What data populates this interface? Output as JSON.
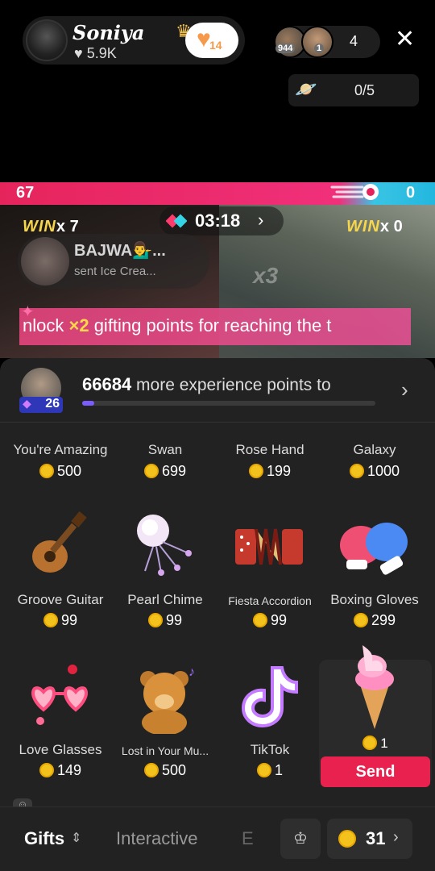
{
  "host": {
    "name": "Soniya",
    "crown_icon": "crown-icon",
    "likes": "5.9K",
    "follow_count": "14"
  },
  "viewers": {
    "badge1": "944",
    "badge2": "1",
    "count": "4"
  },
  "treasure": {
    "value": "0/5"
  },
  "battle": {
    "score_left": "67",
    "score_right": "0",
    "left_ratio": 0.78,
    "win_word": "WIN",
    "win_left": "x 7",
    "win_right": "x 0",
    "timer": "03:18",
    "x3": "x3"
  },
  "gift_notice": {
    "name": "BAJWA💁‍♂️...",
    "sub": "sent Ice Crea..."
  },
  "banner": {
    "pre": "nlock ",
    "highlight": "×2",
    "post": " gifting points for reaching the t"
  },
  "xp": {
    "level": "26",
    "points": "66684",
    "text": " more experience points to",
    "progress": 0.04
  },
  "gifts": [
    {
      "name": "You're Amazing",
      "price": "500"
    },
    {
      "name": "Swan",
      "price": "699"
    },
    {
      "name": "Rose Hand",
      "price": "199"
    },
    {
      "name": "Galaxy",
      "price": "1000"
    },
    {
      "name": "Groove Guitar",
      "price": "99"
    },
    {
      "name": "Pearl Chime",
      "price": "99"
    },
    {
      "name": "Fiesta Accordion",
      "price": "99"
    },
    {
      "name": "Boxing Gloves",
      "price": "299"
    },
    {
      "name": "Love Glasses",
      "price": "149"
    },
    {
      "name": "Lost in Your Mu...",
      "price": "500"
    },
    {
      "name": "TikTok",
      "price": "1"
    }
  ],
  "selected": {
    "price": "1",
    "send_label": "Send"
  },
  "bottom": {
    "tab_gifts": "Gifts",
    "tab_interactive": "Interactive",
    "tab_e": "E",
    "coins": "31"
  }
}
